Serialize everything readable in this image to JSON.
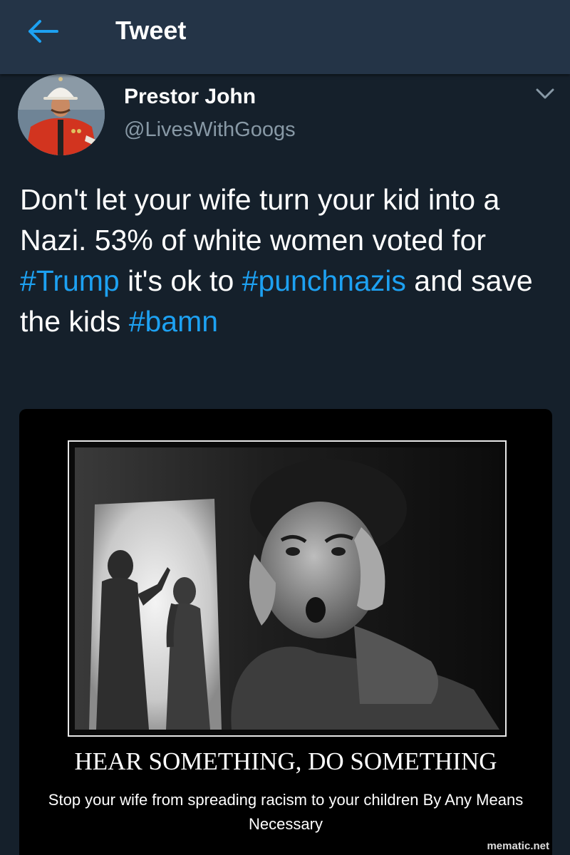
{
  "topbar": {
    "back_icon": "back-arrow-icon",
    "title": "Tweet"
  },
  "author": {
    "name": "Prestor John",
    "handle": "@LivesWithGoogs",
    "menu_icon": "chevron-down-icon"
  },
  "tweet": {
    "text_1": "Don't let your wife turn your kid into a Nazi. 53% of white women voted for ",
    "hashtag_1": "#Trump",
    "text_2": " it's ok to ",
    "hashtag_2": "#punchnazis",
    "text_3": " and save the kids ",
    "hashtag_3": "#bamn"
  },
  "media": {
    "title": "HEAR SOMETHING, DO SOMETHING",
    "caption": "Stop your wife from spreading racism to your children By Any Means Necessary",
    "watermark": "mematic.net"
  },
  "colors": {
    "background": "#15202b",
    "topbar": "#243447",
    "link": "#1da1f2",
    "secondary_text": "#8899a6"
  }
}
